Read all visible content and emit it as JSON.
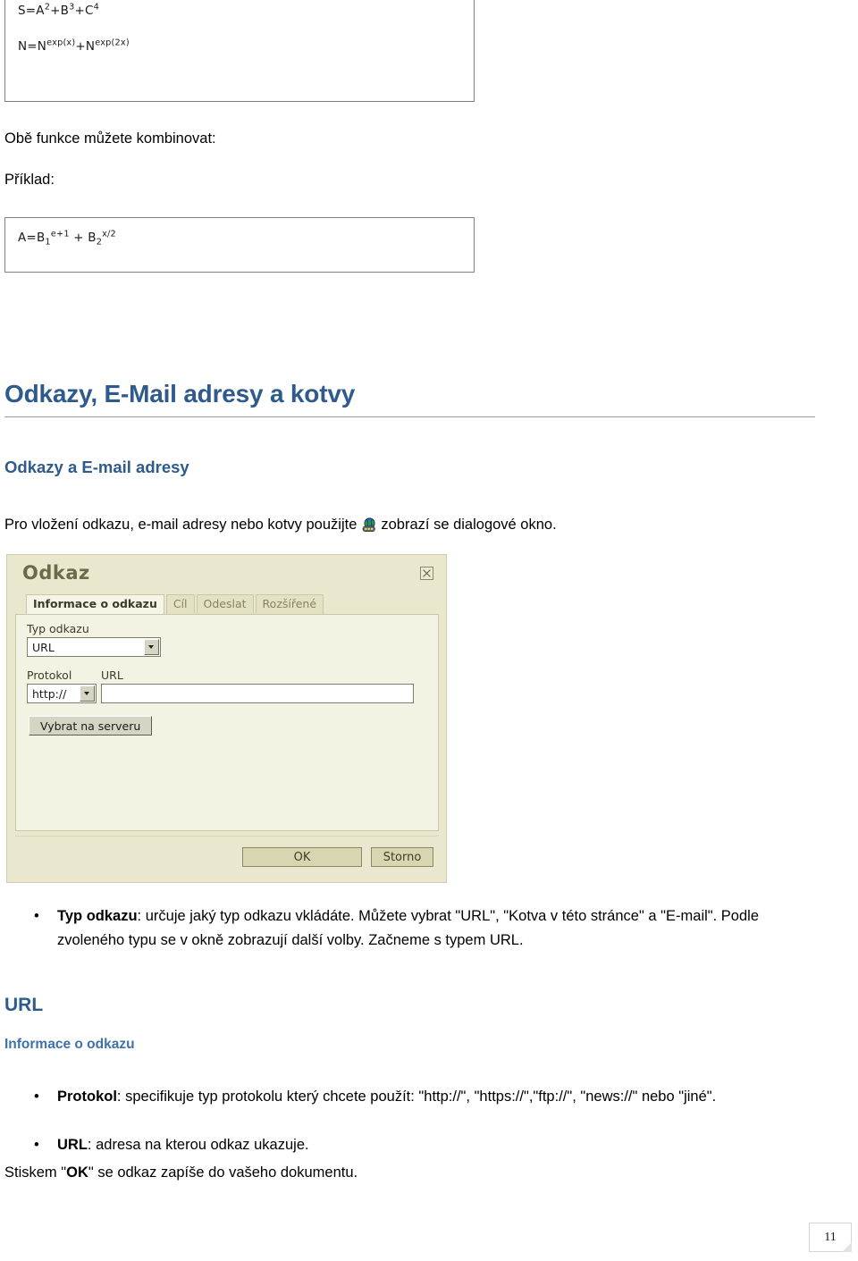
{
  "formula_box_1": {
    "line1": {
      "prefix": "S=A",
      "sup1": "2",
      "mid1": "+B",
      "sup2": "3",
      "mid2": "+C",
      "sup3": "4"
    },
    "line2": {
      "prefix": "N=N",
      "sup1": "exp(x)",
      "mid1": "+N",
      "sup2": "exp(2x)"
    },
    "plain_line1": "S=A2+B3+C4",
    "plain_line2": "N=Nexp(x)+Nexp(2x)"
  },
  "formula_box_2": {
    "line1": {
      "prefix": "A=B",
      "sub1": "1",
      "sup1": "e+1",
      "mid1": " + B",
      "sub2": "2",
      "sup2": "x/2"
    },
    "plain_line1": "A=B1e+1 + B2x/2"
  },
  "paragraphs": {
    "kombinovat": "Obě funkce můžete kombinovat:",
    "priklad": "Příklad:",
    "intro_before_icon": "Pro vložení odkazu, e-mail adresy nebo kotvy použijte",
    "intro_after_icon": "zobrazí se dialogové okno.",
    "stiskem_part1": "Stiskem \"",
    "stiskem_bold": "OK",
    "stiskem_part2": "\" se odkaz zapíše do vašeho dokumentu."
  },
  "headings": {
    "main": "Odkazy, E-Mail adresy a kotvy",
    "sub": "Odkazy a E-mail adresy",
    "url": "URL",
    "informace": "Informace o odkazu"
  },
  "icons": {
    "link_globe": "link-globe-icon",
    "close": "close-icon",
    "dropdown_arrow": "chevron-down-icon"
  },
  "colors": {
    "heading_blue": "#2e5b8c",
    "subheading_blue": "#3f72a8",
    "dialog_background": "#e9e8ce",
    "dialog_body": "#f3f2e3",
    "dialog_title_text": "#6b6a4b"
  },
  "dialog": {
    "title": "Odkaz",
    "tabs": [
      {
        "label": "Informace o odkazu",
        "active": true
      },
      {
        "label": "Cíl",
        "active": false
      },
      {
        "label": "Odeslat",
        "active": false
      },
      {
        "label": "Rozšířené",
        "active": false
      }
    ],
    "fields": {
      "typ_odkazu_label": "Typ odkazu",
      "typ_odkazu_value": "URL",
      "protokol_label": "Protokol",
      "protokol_value": "http://",
      "url_label": "URL",
      "url_value": "",
      "url_placeholder": ""
    },
    "buttons": {
      "browse_server": "Vybrat na serveru",
      "ok": "OK",
      "cancel": "Storno"
    }
  },
  "bullets": {
    "typ_odkazu": {
      "marker": "•",
      "bold": "Typ odkazu",
      "text": ": určuje jaký typ odkazu vkládáte. Můžete vybrat \"URL\", \"Kotva v této stránce\" a \"E-mail\". Podle zvoleného typu se v okně zobrazují další volby. Začneme s typem URL."
    },
    "protokol": {
      "marker": "•",
      "bold": "Protokol",
      "text": ": specifikuje typ protokolu který chcete použít: \"http://\", \"https://\",\"ftp://\", \"news://\" nebo \"jiné\"."
    },
    "url": {
      "marker": "•",
      "bold": "URL",
      "text": ": adresa na kterou odkaz ukazuje."
    }
  },
  "footer": {
    "page_number": "11"
  }
}
